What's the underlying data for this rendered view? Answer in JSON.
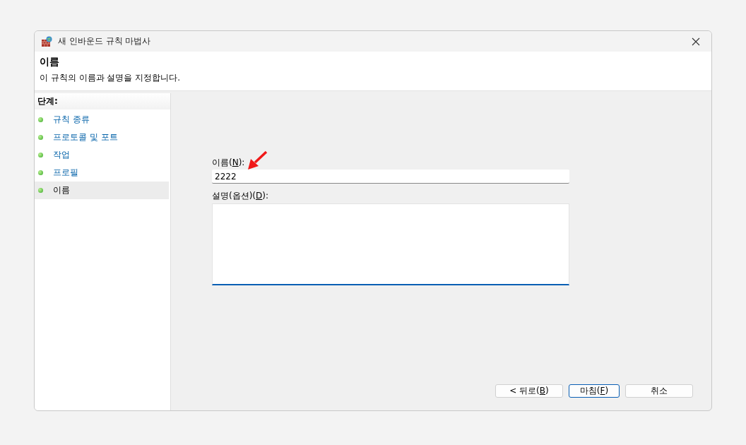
{
  "window": {
    "title": "새 인바운드 규칙 마법사"
  },
  "header": {
    "title": "이름",
    "subtitle": "이 규칙의 이름과 설명을 지정합니다."
  },
  "steps": {
    "heading": "단계:",
    "items": [
      {
        "label": "규칙 종류",
        "selected": false
      },
      {
        "label": "프로토콜 및 포트",
        "selected": false
      },
      {
        "label": "작업",
        "selected": false
      },
      {
        "label": "프로필",
        "selected": false
      },
      {
        "label": "이름",
        "selected": true
      }
    ]
  },
  "form": {
    "name_label": {
      "before": "이름(",
      "mnemonic": "N",
      "after": "):"
    },
    "name_value": "2222",
    "description_label": {
      "before": "설명(옵션)(",
      "mnemonic": "D",
      "after": "):"
    }
  },
  "buttons": [
    {
      "before": "< 뒤로(",
      "mnemonic": "B",
      "after": ")",
      "default": false
    },
    {
      "before": "마침(",
      "mnemonic": "F",
      "after": ")",
      "default": true
    },
    {
      "before": "취소",
      "default": false
    }
  ]
}
